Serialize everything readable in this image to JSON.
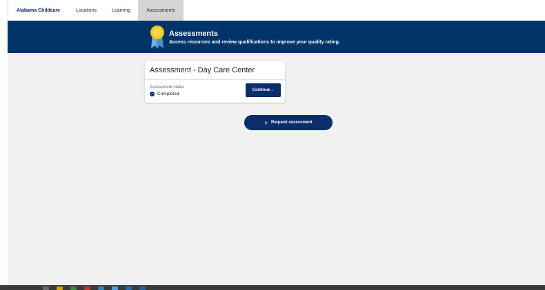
{
  "nav": {
    "brand": "Alabama Childcare",
    "items": [
      {
        "label": "Locations"
      },
      {
        "label": "Learning"
      },
      {
        "label": "Assessments",
        "active": true
      }
    ]
  },
  "banner": {
    "title": "Assessments",
    "subtitle": "Access resources and review qualifications to improve your quality rating.",
    "icon": "award-medal-icon"
  },
  "card": {
    "title": "Assessment - Day Care Center",
    "status_label": "Assessment status",
    "status_value": "Completed",
    "status_icon": "check-circle-icon",
    "continue_label": "Continue→"
  },
  "request_button": {
    "icon": "plus-icon",
    "plus": "+",
    "label": "Request assessment"
  },
  "colors": {
    "brand_navy": "#0b2d6b",
    "banner_bg": "#003469",
    "page_bg": "#f1f1f1",
    "active_tab_bg": "#d4d4d4",
    "medal_gold": "#f5c518",
    "ribbon_blue": "#6fb3e6"
  }
}
